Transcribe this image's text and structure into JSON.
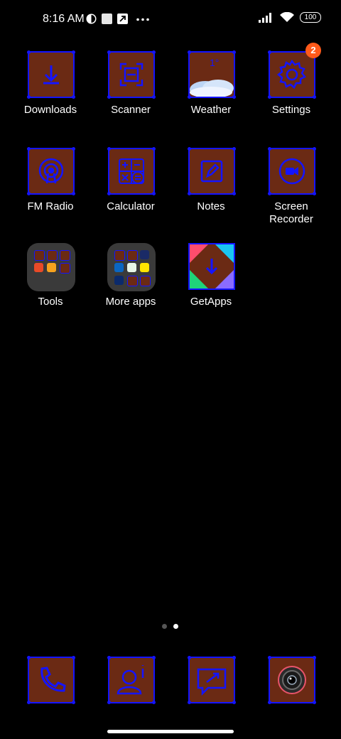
{
  "status_bar": {
    "time": "8:16 AM",
    "battery": "100",
    "icons": [
      "data-saver-icon",
      "square-notification-icon",
      "upload-arrow-icon",
      "more-dots-icon",
      "signal-icon",
      "wifi-icon",
      "battery-icon"
    ]
  },
  "apps": [
    {
      "label": "Downloads",
      "icon": "download-icon"
    },
    {
      "label": "Scanner",
      "icon": "scanner-icon"
    },
    {
      "label": "Weather",
      "icon": "weather-icon"
    },
    {
      "label": "Settings",
      "icon": "gear-icon",
      "badge": "2"
    },
    {
      "label": "FM Radio",
      "icon": "radio-icon"
    },
    {
      "label": "Calculator",
      "icon": "calculator-icon"
    },
    {
      "label": "Notes",
      "icon": "notes-icon"
    },
    {
      "label": "Screen Recorder",
      "icon": "video-camera-icon"
    },
    {
      "label": "Tools",
      "icon": "folder-icon"
    },
    {
      "label": "More apps",
      "icon": "folder-icon"
    },
    {
      "label": "GetApps",
      "icon": "getapps-icon"
    }
  ],
  "weather_temp": "1°",
  "dock": [
    {
      "icon": "phone-icon"
    },
    {
      "icon": "contacts-icon"
    },
    {
      "icon": "messages-icon"
    },
    {
      "icon": "camera-icon"
    }
  ],
  "page_indicator": {
    "pages": 2,
    "active": 2
  },
  "colors": {
    "tile": "#6b2a14",
    "tile_border": "#1414ff",
    "badge": "#ff5a1a"
  }
}
